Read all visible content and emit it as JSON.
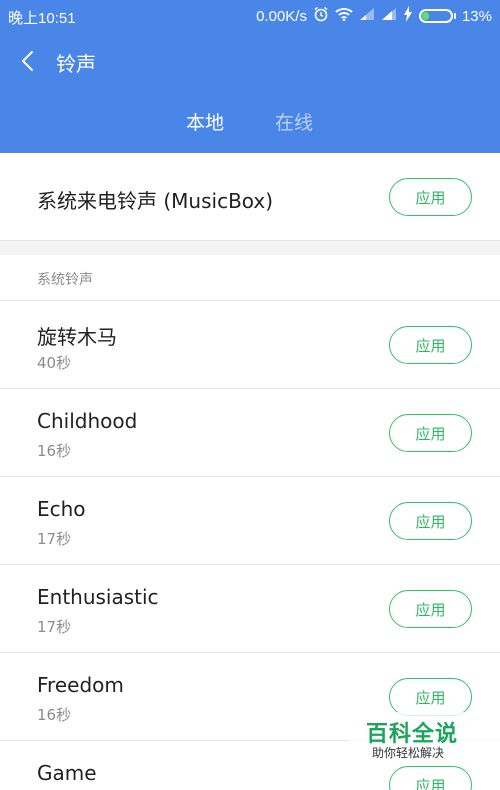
{
  "status_bar": {
    "time": "晚上10:51",
    "network_speed": "0.00K/s",
    "battery_percent": "13%",
    "battery_level": 0.13,
    "icons": [
      "alarm-icon",
      "wifi-icon",
      "signal-icon",
      "signal-icon",
      "charging-icon",
      "battery-icon"
    ]
  },
  "header": {
    "title": "铃声",
    "back_icon": "chevron-left-icon",
    "tabs": [
      {
        "label": "本地",
        "active": true
      },
      {
        "label": "在线",
        "active": false
      }
    ],
    "color": "#4a86e8"
  },
  "current_ringtone": {
    "label": "系统来电铃声 (MusicBox)",
    "button": "应用"
  },
  "section": {
    "title": "系统铃声"
  },
  "ringtones": [
    {
      "name": "旋转木马",
      "duration": "40秒",
      "button": "应用"
    },
    {
      "name": "Childhood",
      "duration": "16秒",
      "button": "应用"
    },
    {
      "name": "Echo",
      "duration": "17秒",
      "button": "应用"
    },
    {
      "name": "Enthusiastic",
      "duration": "17秒",
      "button": "应用"
    },
    {
      "name": "Freedom",
      "duration": "16秒",
      "button": "应用"
    },
    {
      "name": "Game",
      "duration": "",
      "button": "应用"
    }
  ],
  "watermark": {
    "main": "百科全说",
    "sub": "助你轻松解决"
  },
  "colors": {
    "accent_green": "#2fb864",
    "header_blue": "#4a86e8"
  }
}
